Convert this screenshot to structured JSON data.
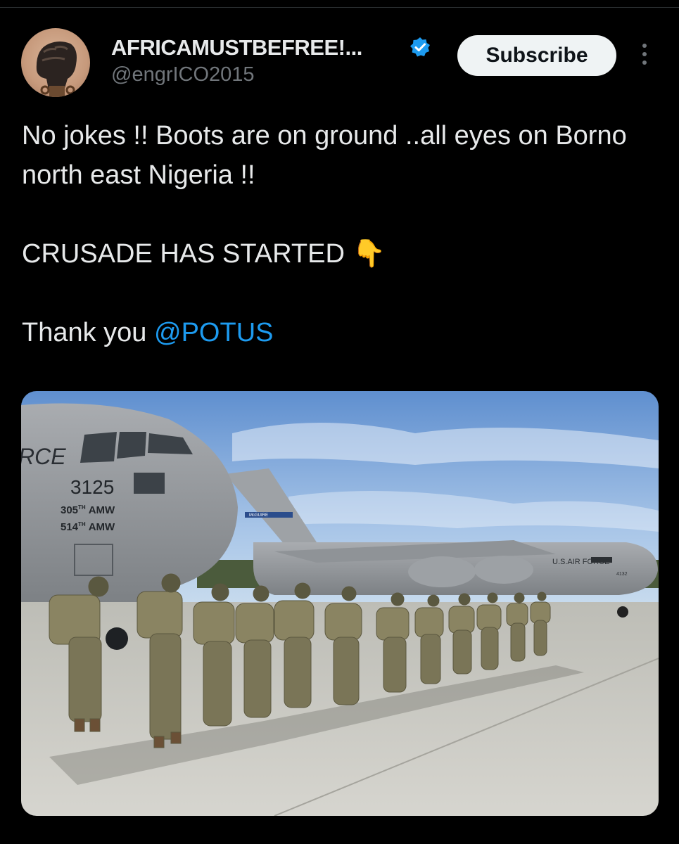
{
  "header": {
    "display_name": "AFRICAMUSTBEFREE!...",
    "handle": "@engrICO2015",
    "subscribe_label": "Subscribe"
  },
  "tweet": {
    "line1": "No jokes !! Boots are on ground ..all eyes on Borno north east Nigeria !!",
    "line2": "CRUSADE HAS STARTED",
    "line2_emoji": "👇",
    "line3_prefix": "Thank you",
    "mention": "@POTUS"
  },
  "media": {
    "front_plane_text": "RCE",
    "tail_number": "3125",
    "wing1": "305",
    "wing1_sup": "TH",
    "wing1_suffix": "AMW",
    "wing2": "514",
    "wing2_sup": "TH",
    "wing2_suffix": "AMW",
    "rear_plane_text": "U.S.AIR FORCE",
    "rear_plane_number": "4132",
    "rear_tail_text": "McGUIRE"
  },
  "colors": {
    "background": "#000000",
    "text": "#e7e9ea",
    "secondary": "#71767b",
    "link": "#1d9bf0",
    "verified": "#1d9bf0"
  },
  "icons": [
    "raised-fist-avatar",
    "verified-badge-icon",
    "more-options-icon"
  ]
}
